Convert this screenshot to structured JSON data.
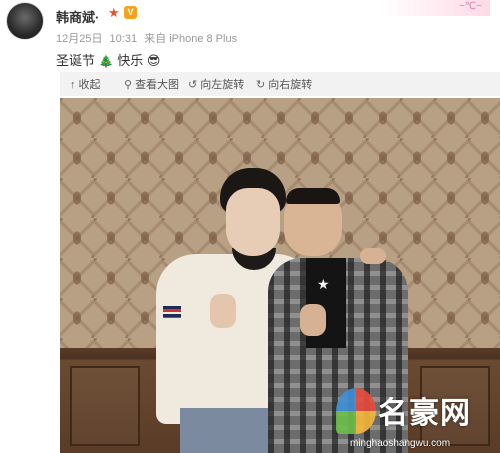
{
  "post": {
    "author": "韩商斌·",
    "meta": {
      "date": "12月25日",
      "time": "10:31",
      "source": "来自 iPhone 8 Plus"
    },
    "content": {
      "text_before": "圣诞节",
      "text_after": "快乐"
    },
    "deco_text": "~℃~"
  },
  "toolbar": {
    "collapse_label": "收起",
    "view_large_label": "查看大图",
    "rotate_left_label": "向左旋转",
    "rotate_right_label": "向右旋转"
  },
  "watermark": {
    "title": "名豪网",
    "url": "minghaoshangwu.com"
  },
  "icons": {
    "star": "star-icon",
    "vip": "vip-badge-icon",
    "tree": "christmas-tree-icon",
    "glasses": "sunglasses-emoji-icon",
    "collapse": "collapse-arrow-icon",
    "zoom": "magnifier-icon",
    "rotate_left": "rotate-left-icon",
    "rotate_right": "rotate-right-icon"
  },
  "colors": {
    "link_gray": "#555555",
    "meta_gray": "#999999",
    "star_orange": "#e8522c",
    "vip_orange": "#f7a21b"
  }
}
